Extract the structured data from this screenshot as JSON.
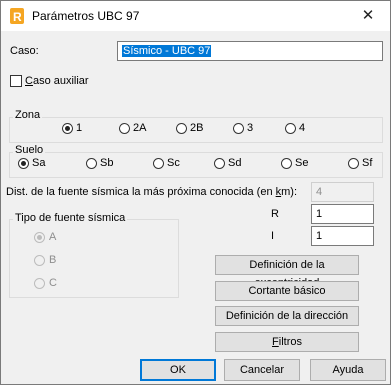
{
  "window": {
    "title": "Parámetros UBC 97",
    "close_glyph": "✕",
    "app_icon_color": "#f5a623"
  },
  "caso": {
    "label": "Caso:",
    "value": "Sísmico - UBC 97"
  },
  "caso_auxiliar": {
    "label_underlined": "C",
    "label_rest": "aso auxiliar",
    "checked": false
  },
  "zona": {
    "legend": "Zona",
    "options": [
      {
        "label": "1",
        "checked": true
      },
      {
        "label": "2A",
        "checked": false
      },
      {
        "label": "2B",
        "checked": false
      },
      {
        "label": "3",
        "checked": false
      },
      {
        "label": "4",
        "checked": false
      }
    ]
  },
  "suelo": {
    "legend": "Suelo",
    "options": [
      {
        "label": "Sa",
        "checked": true
      },
      {
        "label": "Sb",
        "checked": false
      },
      {
        "label": "Sc",
        "checked": false
      },
      {
        "label": "Sd",
        "checked": false
      },
      {
        "label": "Se",
        "checked": false
      },
      {
        "label": "Sf",
        "checked": false
      }
    ]
  },
  "distancia": {
    "label_pre": "Dist. de la fuente sísmica la más próxima conocida (en ",
    "label_ul": "k",
    "label_post": "m):",
    "value": "4"
  },
  "tipo_fuente": {
    "legend": "Tipo de fuente sísmica",
    "options": [
      {
        "label": "A",
        "checked": true
      },
      {
        "label": "B",
        "checked": false
      },
      {
        "label": "C",
        "checked": false
      }
    ]
  },
  "r": {
    "label": "R",
    "value": "1"
  },
  "i": {
    "label": "I",
    "value": "1"
  },
  "buttons": {
    "excentricidad": "Definición de la excentricidad",
    "cortante": "Cortante básico",
    "direccion": "Definición de la dirección",
    "filtros_ul": "F",
    "filtros_rest": "iltros",
    "ok": "OK",
    "cancelar": "Cancelar",
    "ayuda": "Ayuda"
  }
}
